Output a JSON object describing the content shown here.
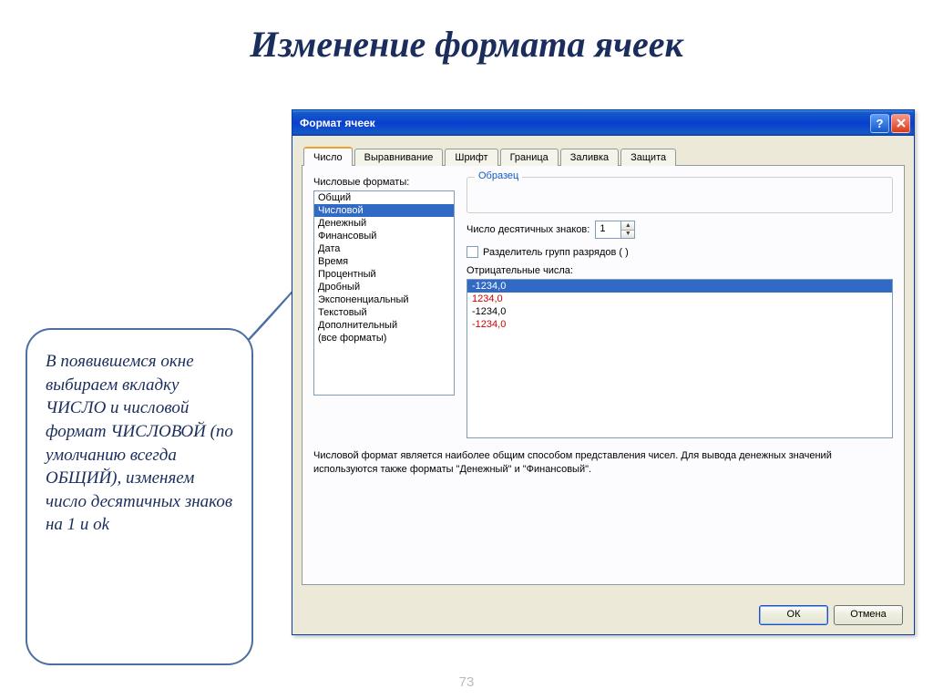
{
  "slide": {
    "title": "Изменение формата ячеек",
    "page_number": "73"
  },
  "callout": {
    "text": "В появившемся окне выбираем вкладку  ЧИСЛО и числовой формат ЧИСЛОВОЙ (по умолчанию всегда ОБЩИЙ), изменяем число десятичных знаков на 1 и ok"
  },
  "dialog": {
    "title": "Формат ячеек",
    "tabs": [
      "Число",
      "Выравнивание",
      "Шрифт",
      "Граница",
      "Заливка",
      "Защита"
    ],
    "active_tab": 0,
    "formats_label": "Числовые форматы:",
    "format_items": [
      "Общий",
      "Числовой",
      "Денежный",
      "Финансовый",
      "Дата",
      "Время",
      "Процентный",
      "Дробный",
      "Экспоненциальный",
      "Текстовый",
      "Дополнительный",
      "(все форматы)"
    ],
    "format_selected": 1,
    "sample_label": "Образец",
    "decimals_label": "Число десятичных знаков:",
    "decimals_value": "1",
    "separator_label": "Разделитель групп разрядов ( )",
    "negative_label": "Отрицательные числа:",
    "negative_items": [
      {
        "text": "-1234,0",
        "red": false,
        "sel": true
      },
      {
        "text": "1234,0",
        "red": true,
        "sel": false
      },
      {
        "text": "-1234,0",
        "red": false,
        "sel": false
      },
      {
        "text": "-1234,0",
        "red": true,
        "sel": false
      }
    ],
    "description": "Числовой формат является наиболее общим способом представления чисел. Для вывода денежных значений используются также форматы \"Денежный\" и \"Финансовый\".",
    "ok": "ОК",
    "cancel": "Отмена"
  }
}
